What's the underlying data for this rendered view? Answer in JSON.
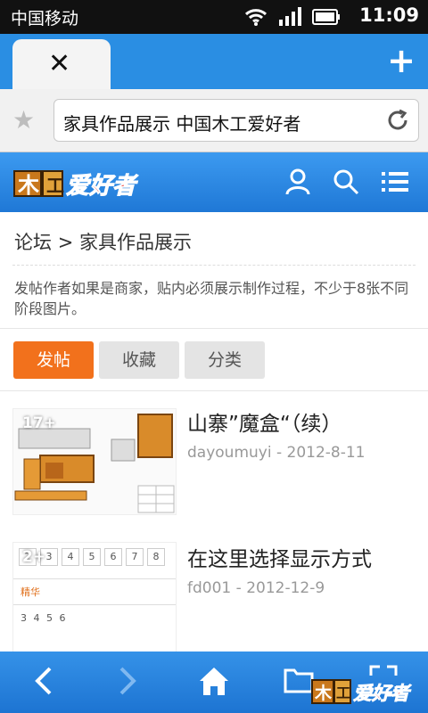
{
  "statusbar": {
    "carrier": "中国移动",
    "time": "11:09"
  },
  "browser": {
    "url_text": "家具作品展示 中国木工爱好者"
  },
  "site": {
    "logo_text": "爱好者"
  },
  "breadcrumb": {
    "forum": "论坛",
    "arrow": ">",
    "section": "家具作品展示"
  },
  "notice": "发帖作者如果是商家，贴内必须展示制作过程，不少于8张不同阶段图片。",
  "buttons": {
    "post": "发帖",
    "favorite": "收藏",
    "category": "分类"
  },
  "threads": [
    {
      "title": "山寨”魔盒“（续）",
      "author": "dayoumuyi",
      "dash": "-",
      "date": "2012-8-11",
      "count": "17+"
    },
    {
      "title": "在这里选择显示方式",
      "author": "fd001",
      "dash": "-",
      "date": "2012-12-9",
      "count": "2+",
      "thumb_row": [
        "2",
        "3",
        "4",
        "5",
        "6",
        "7",
        "8"
      ],
      "thumb_label": "精华",
      "thumb_nums": "3 4 5 6"
    }
  ],
  "bottom_logo_text": "爱好者",
  "colors": {
    "brand_blue": "#2a8ee3",
    "accent_orange": "#f2711c"
  }
}
